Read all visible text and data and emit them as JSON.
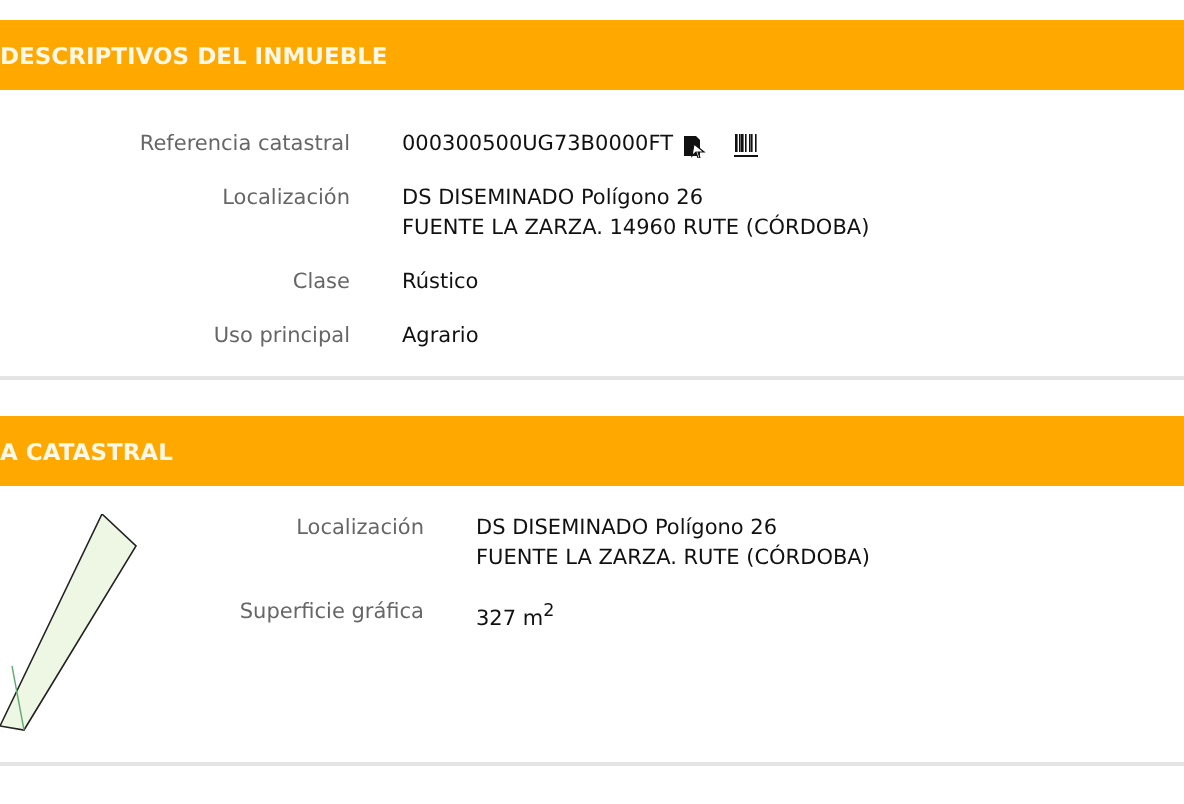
{
  "sections": [
    {
      "title": "DESCRIPTIVOS DEL INMUEBLE",
      "kind": "plain",
      "rows": [
        {
          "label": "Referencia catastral",
          "lines": [
            "000300500UG73B0000FT"
          ],
          "kind": "reference"
        },
        {
          "label": "Localización",
          "lines": [
            "DS DISEMINADO Polígono 26",
            "FUENTE LA ZARZA. 14960 RUTE (CÓRDOBA)"
          ],
          "kind": "text"
        },
        {
          "label": "Clase",
          "lines": [
            "Rústico"
          ],
          "kind": "text"
        },
        {
          "label": "Uso principal",
          "lines": [
            "Agrario"
          ],
          "kind": "text"
        }
      ]
    },
    {
      "title": "A CATASTRAL",
      "kind": "parcel",
      "rows": [
        {
          "label": "Localización",
          "lines": [
            "DS DISEMINADO Polígono 26",
            "FUENTE LA ZARZA. RUTE (CÓRDOBA)"
          ],
          "kind": "text"
        },
        {
          "label": "Superficie gráfica",
          "lines": [
            "327 m$^{2}$"
          ],
          "kind": "text"
        }
      ]
    }
  ]
}
